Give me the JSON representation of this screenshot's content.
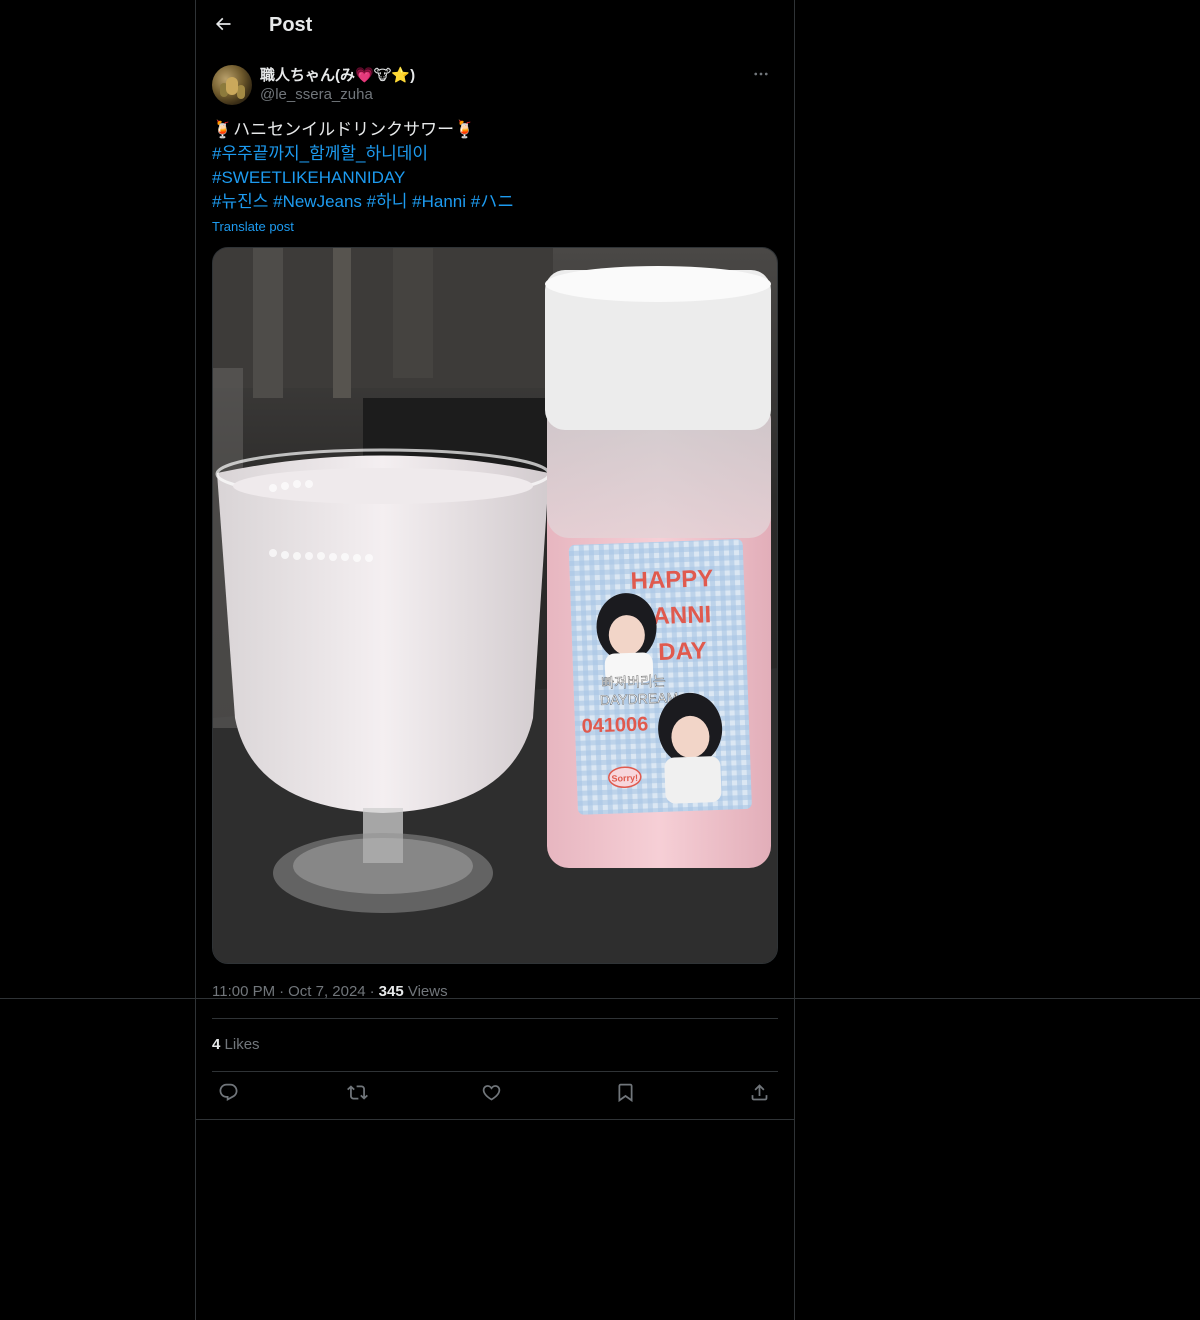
{
  "header": {
    "title": "Post",
    "back_icon": "arrow-left-icon"
  },
  "author": {
    "display_name": "職人ちゃん(み💗🐮⭐)",
    "handle": "@le_ssera_zuha",
    "more_icon": "more-horizontal-icon"
  },
  "tweet": {
    "line1": "🍹ハニセンイルドリンクサワー🍹",
    "hashtag1": "#우주끝까지_함께할_하니데이",
    "hashtag2": "#SWEETLIKEHANNIDAY",
    "hashtags_line": [
      "#뉴진스",
      "#NewJeans",
      "#하니",
      "#Hanni",
      "#ハニ"
    ],
    "translate": "Translate post"
  },
  "media": {
    "label_line1": "HAPPY",
    "label_line2": "HANNI",
    "label_line3": "DAY",
    "label_korean": "빠져버리는",
    "label_daydream": "DAYDREAM",
    "label_date": "041006",
    "label_sticker": "Sorry!"
  },
  "meta": {
    "time": "11:00 PM",
    "date": "Oct 7, 2024",
    "views_count": "345",
    "views_label": "Views",
    "separator": "·"
  },
  "stats": {
    "likes_count": "4",
    "likes_label": "Likes"
  },
  "actions": [
    {
      "name": "reply",
      "icon": "reply-icon"
    },
    {
      "name": "repost",
      "icon": "repost-icon"
    },
    {
      "name": "like",
      "icon": "heart-icon"
    },
    {
      "name": "bookmark",
      "icon": "bookmark-icon"
    },
    {
      "name": "share",
      "icon": "share-icon"
    }
  ],
  "colors": {
    "background": "#000000",
    "text": "#e7e9ea",
    "secondary": "#71767b",
    "link": "#1d9bf0",
    "border": "#2f3336"
  }
}
